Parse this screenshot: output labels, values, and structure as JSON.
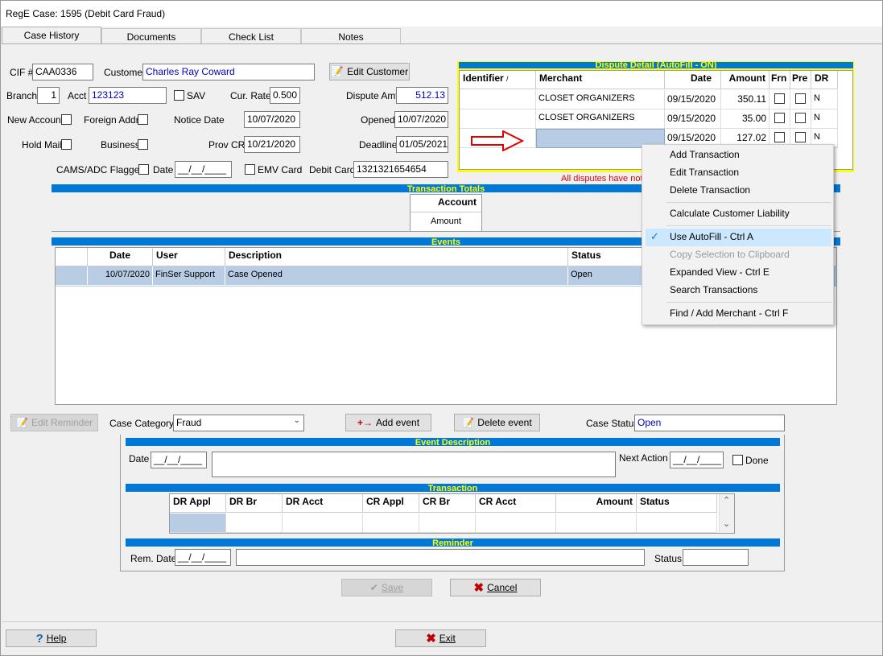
{
  "window": {
    "title": "RegE Case: 1595 (Debit Card Fraud)"
  },
  "tabs": [
    "Case History",
    "Documents",
    "Check List",
    "Notes"
  ],
  "form": {
    "cif_label": "CIF #",
    "cif": "CAA0336",
    "customer_label": "Customer",
    "customer": "Charles Ray Coward",
    "edit_customer": "Edit Customer",
    "branch_label": "Branch",
    "branch": "1",
    "acct_label": "Acct",
    "acct": "123123",
    "sav_label": "SAV",
    "cur_rate_label": "Cur. Rate",
    "cur_rate": "0.500",
    "dispute_amt_label": "Dispute Amt",
    "dispute_amt": "512.13",
    "new_account_label": "New Account",
    "foreign_addr_label": "Foreign Addr",
    "notice_date_label": "Notice Date",
    "notice_date": "10/07/2020",
    "opened_label": "Opened",
    "opened": "10/07/2020",
    "hold_mail_label": "Hold Mail",
    "business_label": "Business",
    "prov_cr_label": "Prov CR",
    "prov_cr": "10/21/2020",
    "deadline_label": "Deadline",
    "deadline": "01/05/2021",
    "cams_label": "CAMS/ADC Flagged",
    "date_label": "Date",
    "date_value": "__/__/____",
    "emv_label": "EMV Card",
    "debit_card_label": "Debit Card",
    "debit_card": "1321321654654"
  },
  "dispute": {
    "title": "Dispute Detail (AutoFill - ON)",
    "headers": [
      "Identifier",
      "Merchant",
      "Date",
      "Amount",
      "Frn",
      "Pre",
      "DR"
    ],
    "rows": [
      {
        "identifier": "",
        "merchant": "CLOSET ORGANIZERS",
        "date": "09/15/2020",
        "amount": "350.11",
        "dr": "N"
      },
      {
        "identifier": "",
        "merchant": "CLOSET ORGANIZERS",
        "date": "09/15/2020",
        "amount": "35.00",
        "dr": "N"
      },
      {
        "identifier": "",
        "merchant": "",
        "date": "09/15/2020",
        "amount": "127.02",
        "dr": "N"
      }
    ],
    "warning": "All disputes have not"
  },
  "totals": {
    "title": "Transaction Totals",
    "header": "Account",
    "row": "Amount"
  },
  "events": {
    "title": "Events",
    "headers": [
      "Date",
      "User",
      "Description",
      "Status"
    ],
    "rows": [
      {
        "date": "10/07/2020",
        "user": "FinSer Support",
        "description": "Case Opened",
        "status": "Open"
      }
    ]
  },
  "controls": {
    "edit_reminder": "Edit Reminder",
    "case_category_label": "Case Category",
    "case_category": "Fraud",
    "add_event": "Add event",
    "delete_event": "Delete event",
    "case_status_label": "Case Status",
    "case_status": "Open"
  },
  "event_desc": {
    "title": "Event Description",
    "date_label": "Date",
    "date": "__/__/____",
    "next_action_label": "Next Action",
    "next_action": "__/__/____",
    "done_label": "Done"
  },
  "transaction": {
    "title": "Transaction",
    "headers": [
      "DR Appl",
      "DR Br",
      "DR Acct",
      "CR Appl",
      "CR Br",
      "CR Acct",
      "Amount",
      "Status"
    ]
  },
  "reminder": {
    "title": "Reminder",
    "rem_date_label": "Rem. Date",
    "rem_date": "__/__/____",
    "status_label": "Status"
  },
  "buttons": {
    "save": "Save",
    "cancel": "Cancel",
    "help": "Help",
    "exit": "Exit"
  },
  "context_menu": {
    "items": [
      "Add Transaction",
      "Edit Transaction",
      "Delete Transaction",
      "Calculate Customer Liability",
      "Use AutoFill - Ctrl A",
      "Copy Selection to Clipboard",
      "Expanded View - Ctrl E",
      "Search Transactions",
      "Find / Add Merchant - Ctrl F"
    ]
  },
  "colors": {
    "accent_bar": "#0078d7",
    "bar_text": "#ffff00",
    "selected_row": "#b8cce4",
    "warning": "#e00000"
  }
}
